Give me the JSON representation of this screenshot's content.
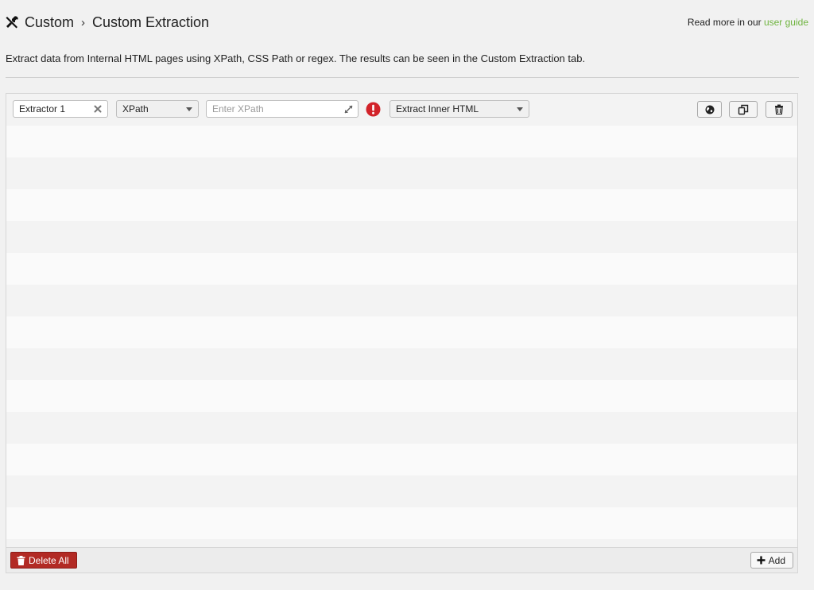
{
  "header": {
    "breadcrumb_root": "Custom",
    "breadcrumb_separator": "›",
    "breadcrumb_current": "Custom Extraction",
    "guide_prefix": "Read more in our ",
    "guide_link": "user guide"
  },
  "description": "Extract data from Internal HTML pages using XPath, CSS Path or regex. The results can be seen in the Custom Extraction tab.",
  "extractor": {
    "name": "Extractor 1",
    "type": "XPath",
    "xpath_placeholder": "Enter XPath",
    "xpath_value": "",
    "mode": "Extract Inner HTML"
  },
  "footer": {
    "delete_all_label": "Delete All",
    "add_label": "Add"
  },
  "colors": {
    "accent_link": "#6fb43f",
    "danger": "#b22a24",
    "warning": "#d2232a"
  },
  "icons": {
    "title": "tools-icon",
    "clear": "close-icon",
    "expand": "expand-icon",
    "warning": "alert-icon",
    "globe": "globe-icon",
    "duplicate": "copy-icon",
    "delete": "trash-icon",
    "add": "plus-icon"
  }
}
